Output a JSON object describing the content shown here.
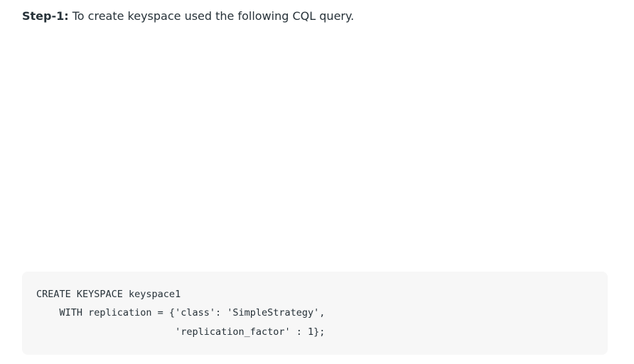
{
  "step": {
    "label": "Step-1:",
    "text": " To create keyspace used the following CQL query."
  },
  "code": {
    "lines": [
      "CREATE KEYSPACE keyspace1",
      "    WITH replication = {'class': 'SimpleStrategy',",
      "                        'replication_factor' : 1};"
    ]
  }
}
